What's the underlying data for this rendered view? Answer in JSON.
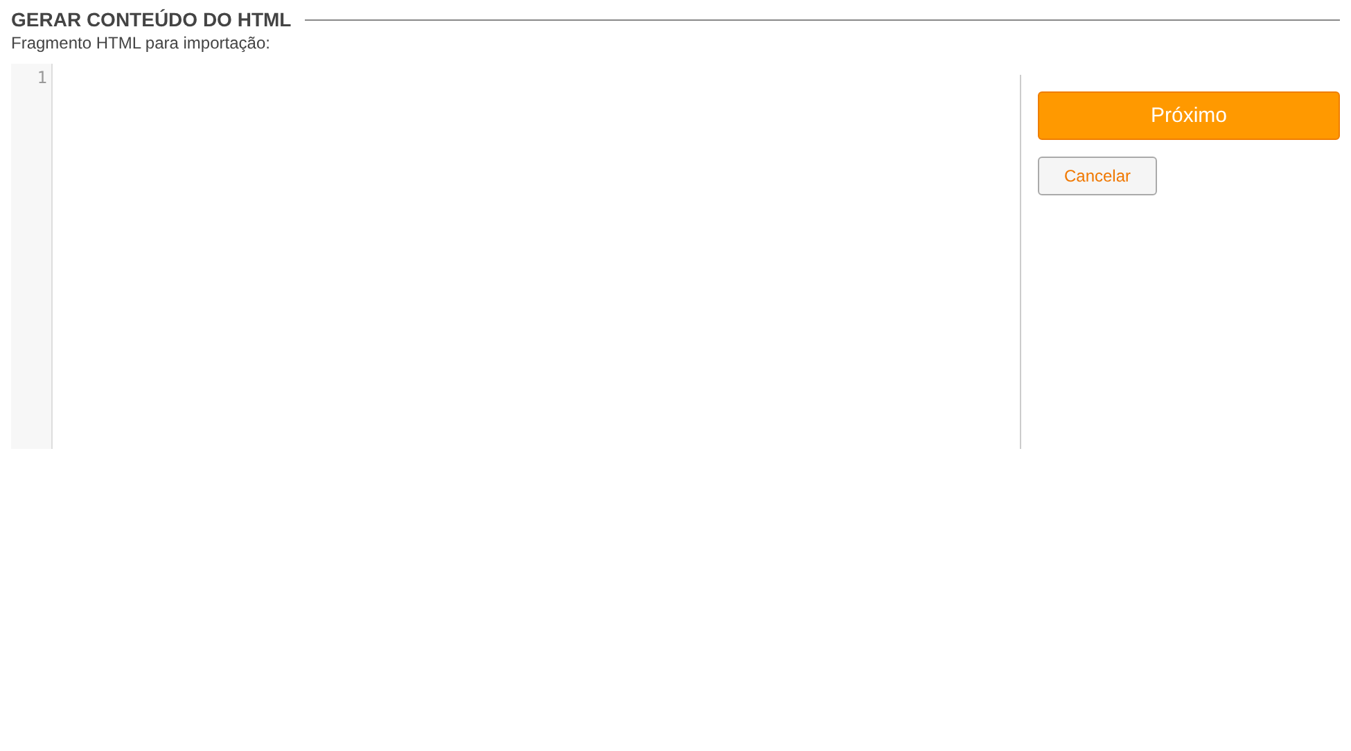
{
  "title": "GERAR CONTEÚDO DO HTML",
  "subtitle": "Fragmento HTML para importação:",
  "editor": {
    "line_numbers": [
      "1"
    ]
  },
  "buttons": [
    {
      "label": "Próximo",
      "kind": "primary"
    },
    {
      "label": "Cancelar",
      "kind": "secondary"
    }
  ]
}
